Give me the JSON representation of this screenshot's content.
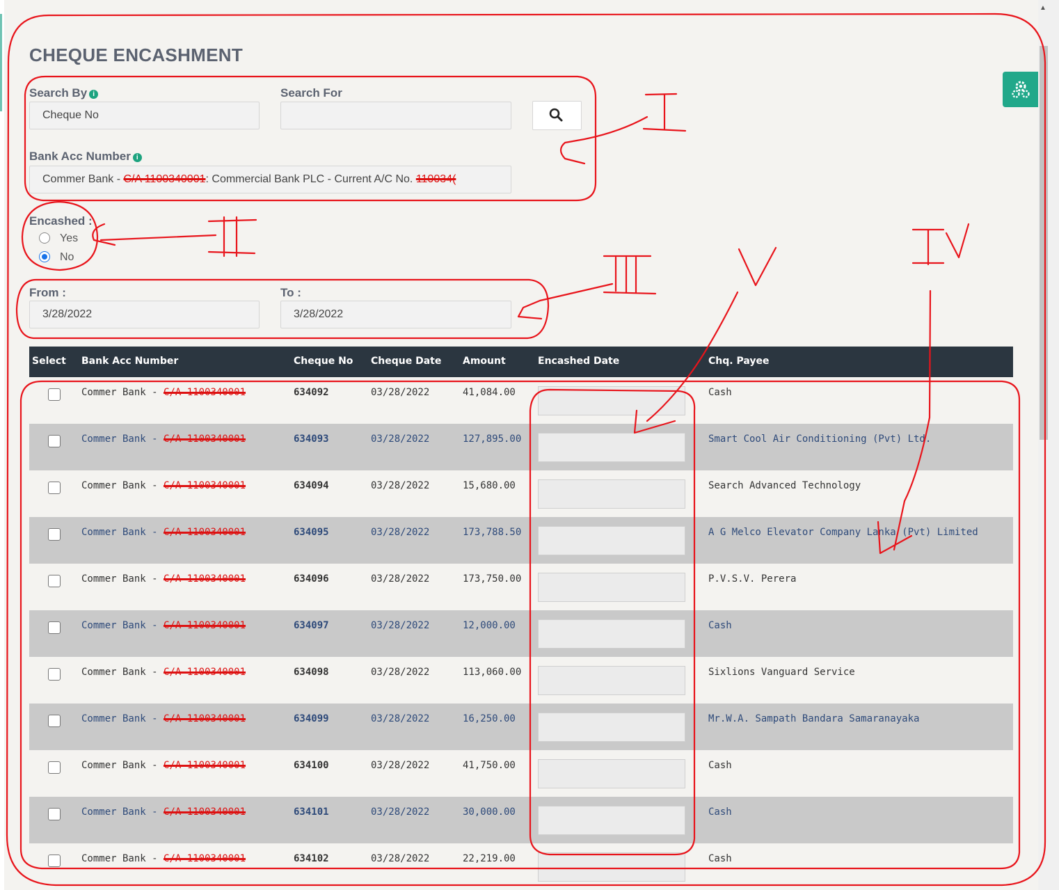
{
  "page": {
    "title": "CHEQUE ENCASHMENT"
  },
  "search": {
    "search_by_label": "Search By",
    "search_by_value": "Cheque No",
    "search_for_label": "Search For",
    "search_for_value": "",
    "bank_acc_label": "Bank Acc Number",
    "bank_acc_value_prefix": "Commer Bank - ",
    "bank_acc_value_redacted": "C/A 1100340001",
    "bank_acc_value_middle": ": Commercial Bank PLC - Current A/C No. ",
    "bank_acc_value_redacted_2": "110034("
  },
  "encashed": {
    "label": "Encashed :",
    "options": [
      "Yes",
      "No"
    ],
    "selected": "No"
  },
  "dates": {
    "from_label": "From :",
    "from_value": "3/28/2022",
    "to_label": "To :",
    "to_value": "3/28/2022"
  },
  "table": {
    "headers": [
      "Select",
      "Bank Acc Number",
      "Cheque No",
      "Cheque Date",
      "Amount",
      "Encashed Date",
      "Chq. Payee"
    ],
    "rows": [
      {
        "bank": "Commer Bank -",
        "bank_redacted": "C/A 1100340001",
        "cheque_no": "634092",
        "date": "03/28/2022",
        "amount": "41,084.00",
        "payee": "Cash"
      },
      {
        "bank": "Commer Bank -",
        "bank_redacted": "C/A 1100340001",
        "cheque_no": "634093",
        "date": "03/28/2022",
        "amount": "127,895.00",
        "payee": "Smart Cool Air Conditioning (Pvt) Ltd."
      },
      {
        "bank": "Commer Bank -",
        "bank_redacted": "C/A 1100340001",
        "cheque_no": "634094",
        "date": "03/28/2022",
        "amount": "15,680.00",
        "payee": "Search Advanced Technology"
      },
      {
        "bank": "Commer Bank -",
        "bank_redacted": "C/A 1100340001",
        "cheque_no": "634095",
        "date": "03/28/2022",
        "amount": "173,788.50",
        "payee": "A G Melco Elevator Company Lanka (Pvt) Limited"
      },
      {
        "bank": "Commer Bank -",
        "bank_redacted": "C/A 1100340001",
        "cheque_no": "634096",
        "date": "03/28/2022",
        "amount": "173,750.00",
        "payee": "P.V.S.V. Perera"
      },
      {
        "bank": "Commer Bank -",
        "bank_redacted": "C/A 1100340001",
        "cheque_no": "634097",
        "date": "03/28/2022",
        "amount": "12,000.00",
        "payee": "Cash"
      },
      {
        "bank": "Commer Bank -",
        "bank_redacted": "C/A 1100340001",
        "cheque_no": "634098",
        "date": "03/28/2022",
        "amount": "113,060.00",
        "payee": "Sixlions Vanguard Service"
      },
      {
        "bank": "Commer Bank -",
        "bank_redacted": "C/A 1100340001",
        "cheque_no": "634099",
        "date": "03/28/2022",
        "amount": "16,250.00",
        "payee": "Mr.W.A. Sampath Bandara Samaranayaka"
      },
      {
        "bank": "Commer Bank -",
        "bank_redacted": "C/A 1100340001",
        "cheque_no": "634100",
        "date": "03/28/2022",
        "amount": "41,750.00",
        "payee": "Cash"
      },
      {
        "bank": "Commer Bank -",
        "bank_redacted": "C/A 1100340001",
        "cheque_no": "634101",
        "date": "03/28/2022",
        "amount": "30,000.00",
        "payee": "Cash"
      },
      {
        "bank": "Commer Bank -",
        "bank_redacted": "C/A 1100340001",
        "cheque_no": "634102",
        "date": "03/28/2022",
        "amount": "22,219.00",
        "payee": "Cash"
      }
    ]
  },
  "annotations": {
    "marks": [
      "I",
      "II",
      "III",
      "IV",
      "V"
    ],
    "color": "#e8141b"
  },
  "icons": {
    "search": "search-icon",
    "info": "info-icon",
    "settings": "gear-icon"
  }
}
